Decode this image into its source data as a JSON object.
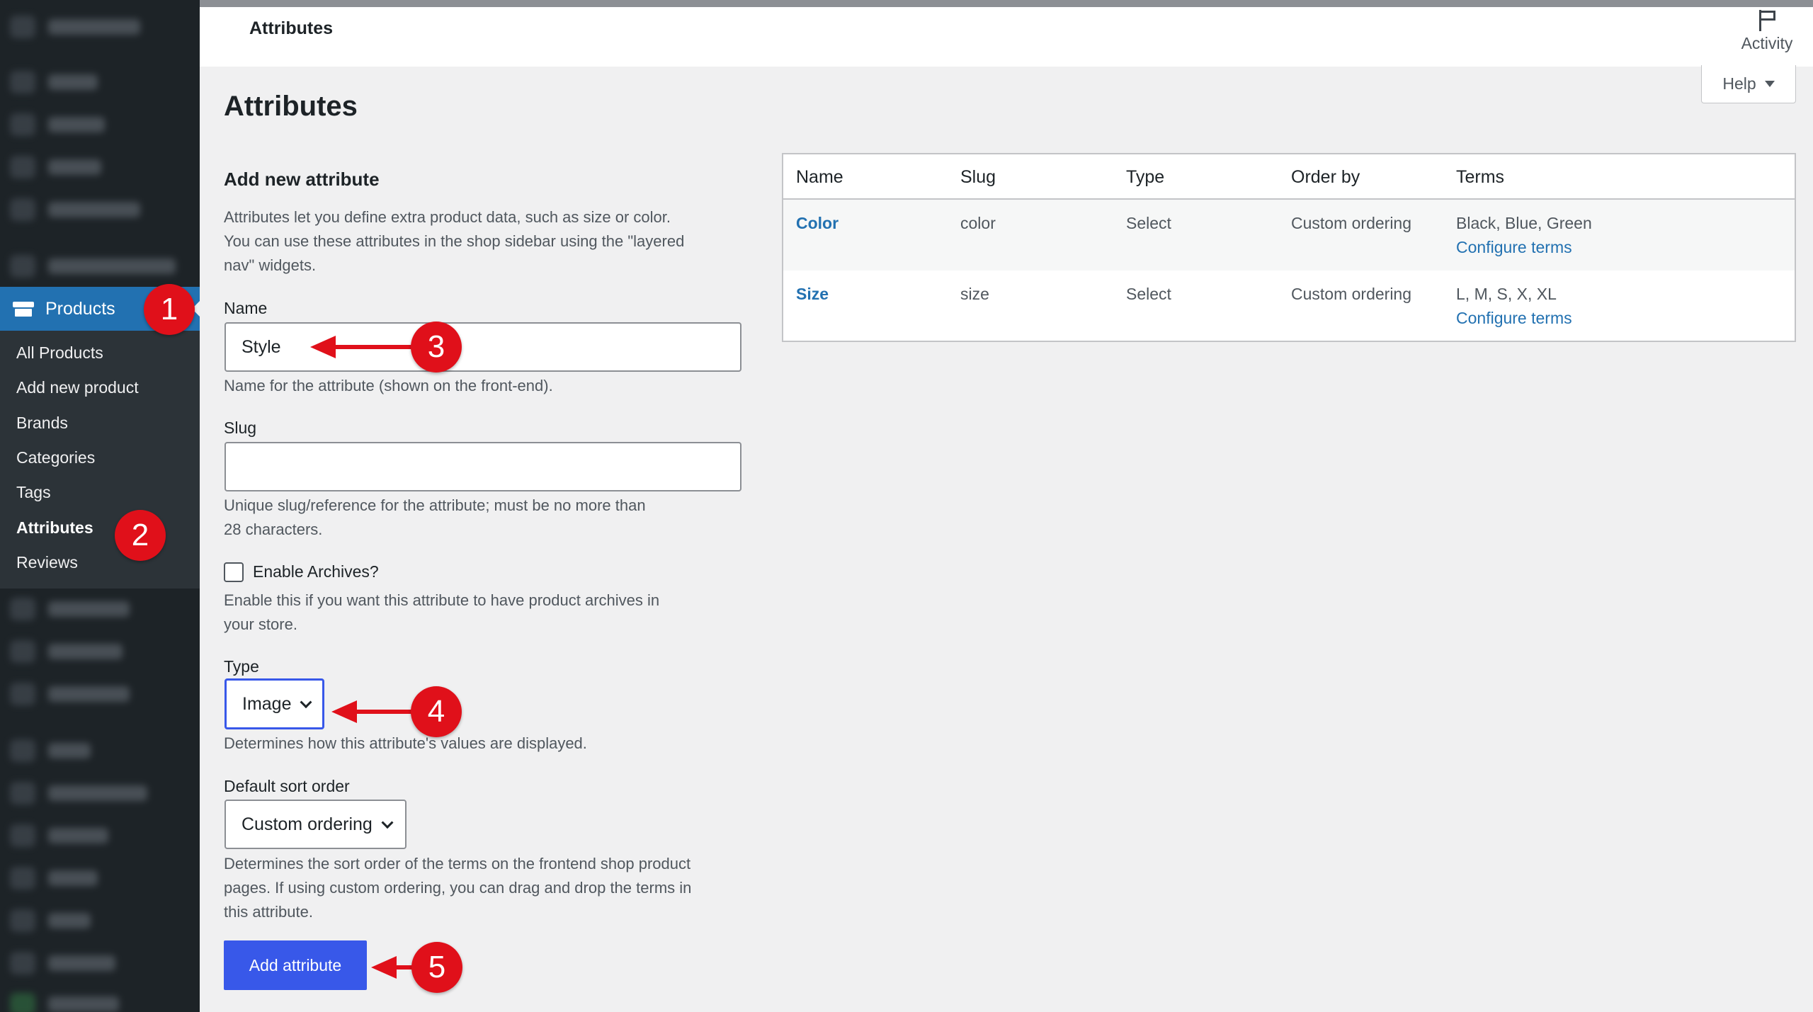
{
  "header": {
    "title": "Attributes",
    "activity_label": "Activity",
    "help_label": "Help"
  },
  "page": {
    "title": "Attributes"
  },
  "sidebar": {
    "products_label": "Products",
    "submenu": [
      "All Products",
      "Add new product",
      "Brands",
      "Categories",
      "Tags",
      "Attributes",
      "Reviews"
    ],
    "active_submenu": "Attributes"
  },
  "form": {
    "heading": "Add new attribute",
    "intro_line1": "Attributes let you define extra product data, such as size or color.",
    "intro_line2": "You can use these attributes in the shop sidebar using the \"layered",
    "intro_line3": "nav\" widgets.",
    "name_label": "Name",
    "name_value": "Style",
    "name_help": "Name for the attribute (shown on the front-end).",
    "slug_label": "Slug",
    "slug_value": "",
    "slug_help_line1": "Unique slug/reference for the attribute; must be no more than",
    "slug_help_line2": "28 characters.",
    "archives_label": "Enable Archives?",
    "archives_checked": false,
    "archives_help_line1": "Enable this if you want this attribute to have product archives in",
    "archives_help_line2": "your store.",
    "type_label": "Type",
    "type_value": "Image",
    "type_help": "Determines how this attribute's values are displayed.",
    "sort_label": "Default sort order",
    "sort_value": "Custom ordering",
    "sort_help_line1": "Determines the sort order of the terms on the frontend shop product",
    "sort_help_line2": "pages. If using custom ordering, you can drag and drop the terms in",
    "sort_help_line3": "this attribute.",
    "submit_label": "Add attribute"
  },
  "table": {
    "columns": [
      "Name",
      "Slug",
      "Type",
      "Order by",
      "Terms"
    ],
    "rows": [
      {
        "name": "Color",
        "slug": "color",
        "type": "Select",
        "order_by": "Custom ordering",
        "terms": "Black, Blue, Green",
        "action": "Configure terms"
      },
      {
        "name": "Size",
        "slug": "size",
        "type": "Select",
        "order_by": "Custom ordering",
        "terms": "L, M, S, X, XL",
        "action": "Configure terms"
      }
    ]
  },
  "annotations": {
    "step1": "1",
    "step2": "2",
    "step3": "3",
    "step4": "4",
    "step5": "5"
  },
  "colors": {
    "sidebar_bg": "#1d2327",
    "active_menu": "#2271b1",
    "primary_button": "#3858e9",
    "link": "#2271b1",
    "annotation_red": "#e0101a"
  }
}
